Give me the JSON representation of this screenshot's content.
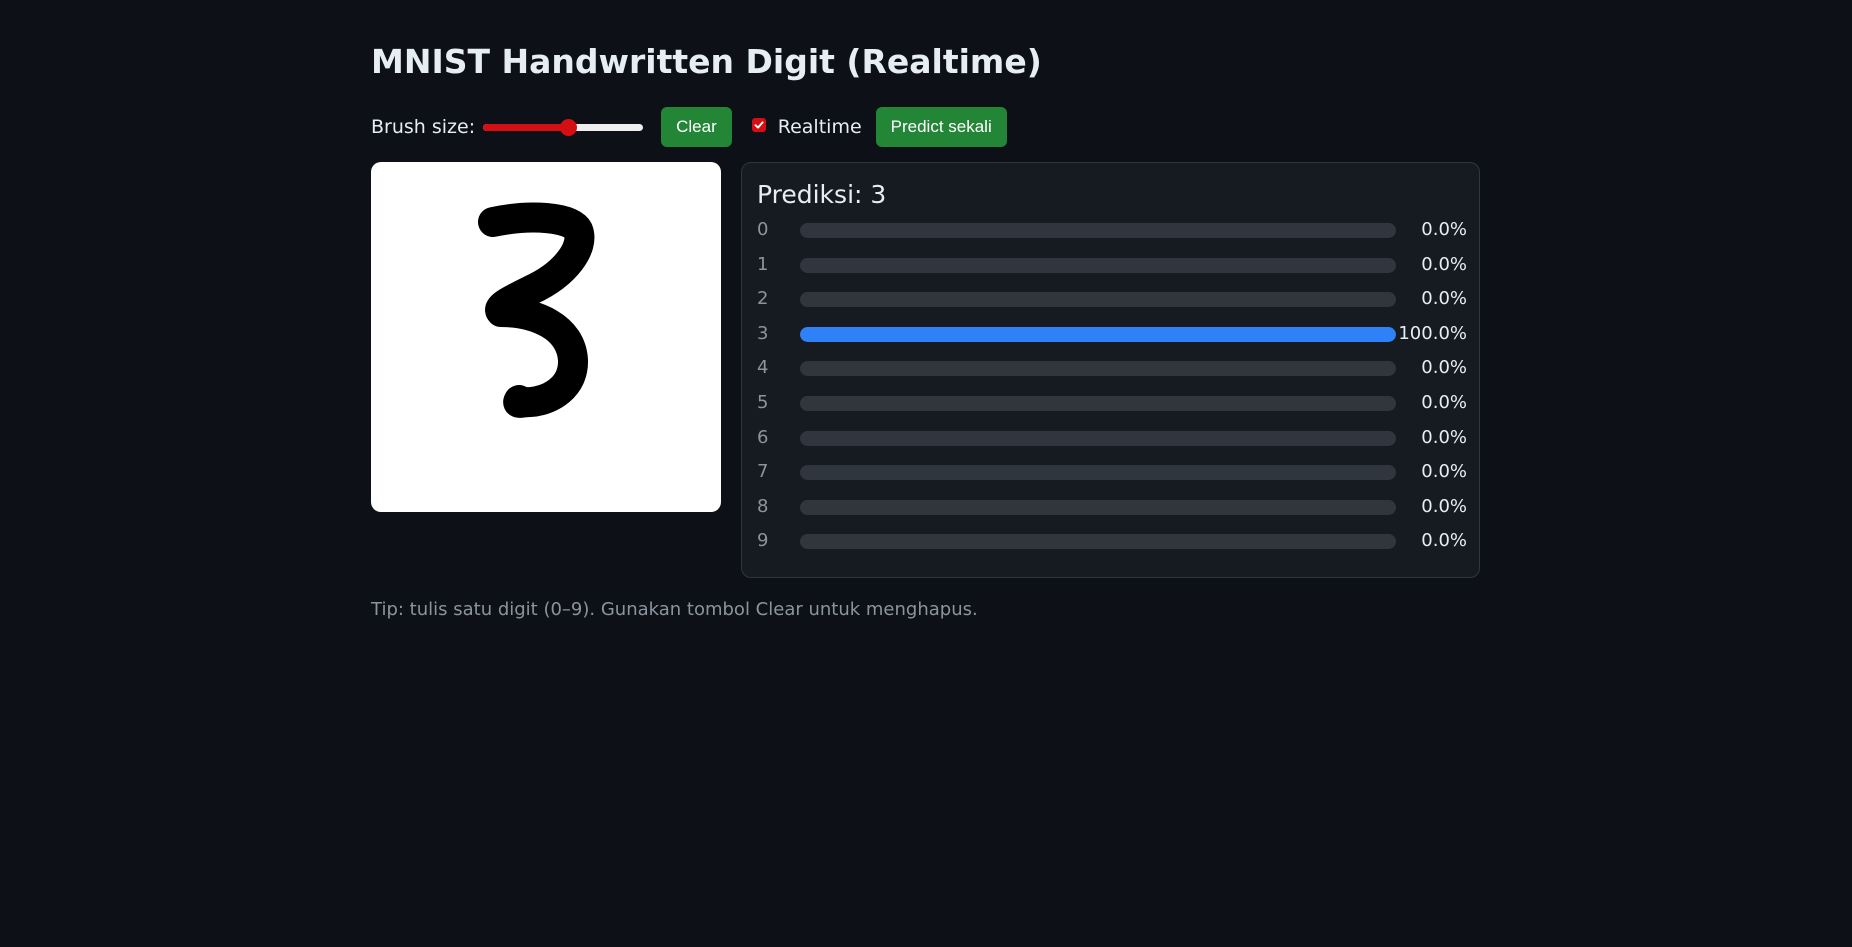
{
  "title": "MNIST Handwritten Digit (Realtime)",
  "controls": {
    "brush_label": "Brush size:",
    "brush_value_fraction": 0.53,
    "clear_label": "Clear",
    "realtime_checked": true,
    "realtime_label": "Realtime",
    "predict_label": "Predict sekali"
  },
  "prediction": {
    "title": "Prediksi: 3",
    "rows": [
      {
        "digit": "0",
        "pct": "0.0%",
        "value": 0.0
      },
      {
        "digit": "1",
        "pct": "0.0%",
        "value": 0.0
      },
      {
        "digit": "2",
        "pct": "0.0%",
        "value": 0.0
      },
      {
        "digit": "3",
        "pct": "100.0%",
        "value": 100.0
      },
      {
        "digit": "4",
        "pct": "0.0%",
        "value": 0.0
      },
      {
        "digit": "5",
        "pct": "0.0%",
        "value": 0.0
      },
      {
        "digit": "6",
        "pct": "0.0%",
        "value": 0.0
      },
      {
        "digit": "7",
        "pct": "0.0%",
        "value": 0.0
      },
      {
        "digit": "8",
        "pct": "0.0%",
        "value": 0.0
      },
      {
        "digit": "9",
        "pct": "0.0%",
        "value": 0.0
      }
    ]
  },
  "tip": "Tip: tulis satu digit (0–9). Gunakan tombol Clear untuk menghapus.",
  "colors": {
    "background": "#0d1117",
    "panel": "#161b22",
    "accent_button": "#238636",
    "bar_active": "#2f81f7",
    "bar_track": "#30363d",
    "slider_accent": "#d40f14"
  }
}
